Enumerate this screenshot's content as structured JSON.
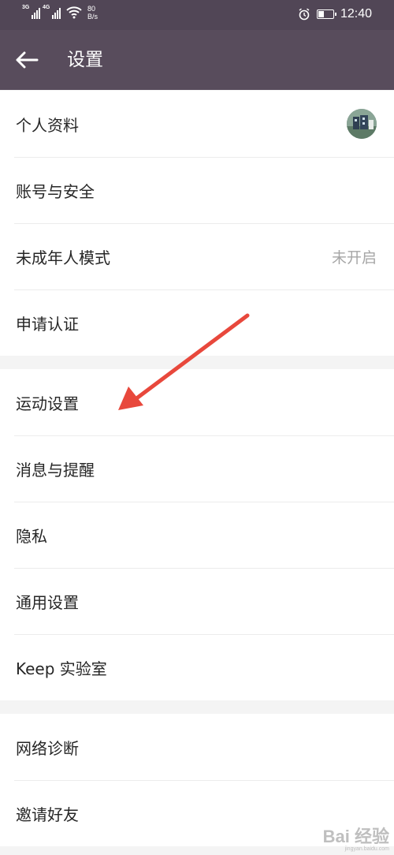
{
  "status_bar": {
    "sim1": "3G",
    "sim2": "4G",
    "net_speed_value": "80",
    "net_speed_unit": "B/s",
    "time": "12:40",
    "icons": [
      "signal-icon",
      "signal-icon",
      "wifi-icon",
      "alarm-icon",
      "battery-icon"
    ]
  },
  "header": {
    "back_icon": "back-arrow-icon",
    "title": "设置"
  },
  "group1": [
    {
      "label": "个人资料",
      "trailing": "avatar"
    },
    {
      "label": "账号与安全"
    },
    {
      "label": "未成年人模式",
      "value": "未开启"
    },
    {
      "label": "申请认证"
    }
  ],
  "group2": [
    {
      "label": "运动设置"
    },
    {
      "label": "消息与提醒"
    },
    {
      "label": "隐私"
    },
    {
      "label": "通用设置"
    },
    {
      "label": "Keep 实验室"
    }
  ],
  "group3": [
    {
      "label": "网络诊断"
    },
    {
      "label": "邀请好友"
    }
  ],
  "annotation": {
    "type": "red-arrow",
    "points_to": "运动设置",
    "color": "#e8483c"
  },
  "watermark": {
    "logo": "Bai 经验",
    "sub": "jingyan.baidu.com"
  }
}
